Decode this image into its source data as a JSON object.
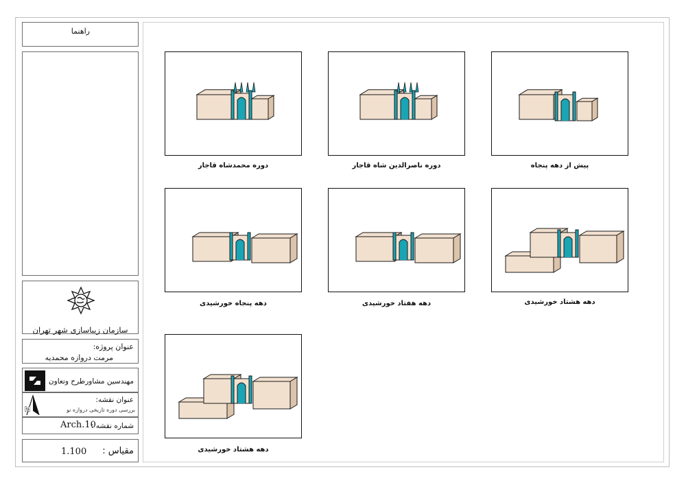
{
  "titleblock": {
    "legend_title": "راهنما",
    "org_name": "سازمان زیباسازی شهر تهران",
    "project_label": "عنوان پروژه:",
    "project_value": "مرمت دروازه محمدیه",
    "firm_name": "مهندسین مشاورطرح وتعاون",
    "map_title_label": "عنوان نقشه:",
    "map_title_value": "بررسی دوره تاریخی دروازه نو",
    "map_number_label": "شماره نقشه :",
    "map_number_value": "Arch.10",
    "scale_label": "مقیاس :",
    "scale_value": "1.100",
    "north_letter": "N"
  },
  "panels": [
    {
      "caption": "پیش از دهه پنجاه",
      "style": 1
    },
    {
      "caption": "دوره ناصرالدین شاه قاجار",
      "style": 2
    },
    {
      "caption": "دوره محمدشاه قاجار",
      "style": 2
    },
    {
      "caption": "دهه هشتاد خورشیدی",
      "style": 4
    },
    {
      "caption": "دهه هفتاد خورشیدی",
      "style": 3
    },
    {
      "caption": "دهه پنجاه خورشیدی",
      "style": 3
    },
    {
      "caption": "دهه هشتاد خورشیدی",
      "style": 4
    }
  ],
  "colors": {
    "building_fill": "#f2e0cf",
    "building_shade": "#dcc3ab",
    "gate_accent": "#1aa5b5",
    "line": "#1a1a1a"
  }
}
